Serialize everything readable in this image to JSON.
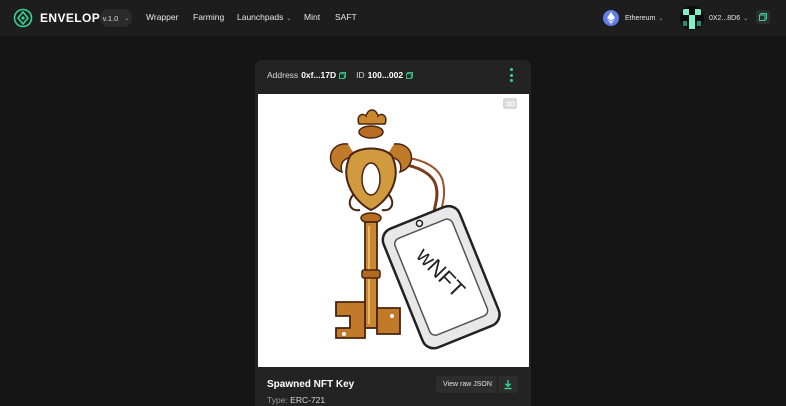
{
  "brand": {
    "name": "ENVELOP",
    "version": "v.1.0"
  },
  "nav": {
    "items": [
      "Wrapper",
      "Farming",
      "Launchpads",
      "Mint",
      "SAFT"
    ]
  },
  "network": {
    "label": "Ethereum"
  },
  "wallet": {
    "address": "0X2...8D6"
  },
  "token": {
    "address_label": "Address",
    "address_value": "0xf...17D",
    "id_label": "ID",
    "id_value": "100...002",
    "name": "Spawned NFT Key",
    "type_label": "Type:",
    "type_value": "ERC-721",
    "view_json_label": "View raw JSON",
    "tag_text": "wNFT"
  },
  "colors": {
    "accent": "#34d399",
    "background": "#151515",
    "header": "#1d1d1d",
    "card": "#232323",
    "eth": "#627eea"
  }
}
